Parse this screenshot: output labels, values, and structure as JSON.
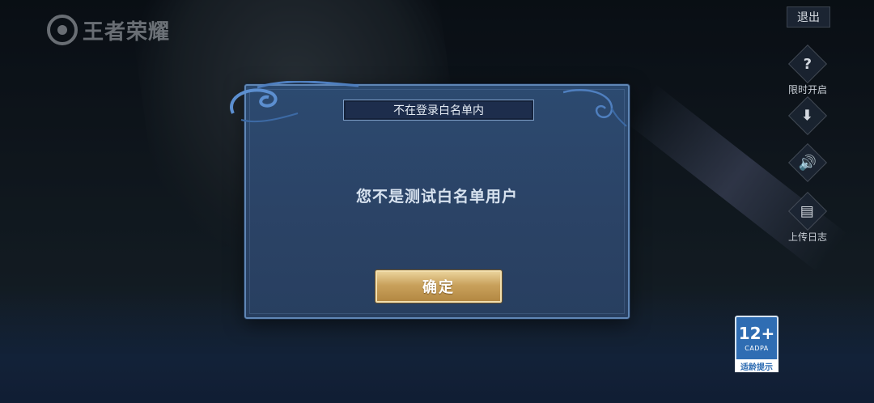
{
  "logo": {
    "text": "王者荣耀"
  },
  "header": {
    "exit_label": "退出"
  },
  "side_menu": {
    "limited_open_label": "限时开启",
    "upload_log_label": "上传日志"
  },
  "age_rating": {
    "number": "12+",
    "org": "CADPA",
    "tip": "适龄提示"
  },
  "dialog": {
    "title": "不在登录白名单内",
    "message": "您不是测试白名单用户",
    "confirm_label": "确定"
  },
  "colors": {
    "dialog_bg": "#2b4366",
    "dialog_border": "#5f86b5",
    "button_gold": "#c9a15c",
    "age_badge_blue": "#2f6db3"
  }
}
